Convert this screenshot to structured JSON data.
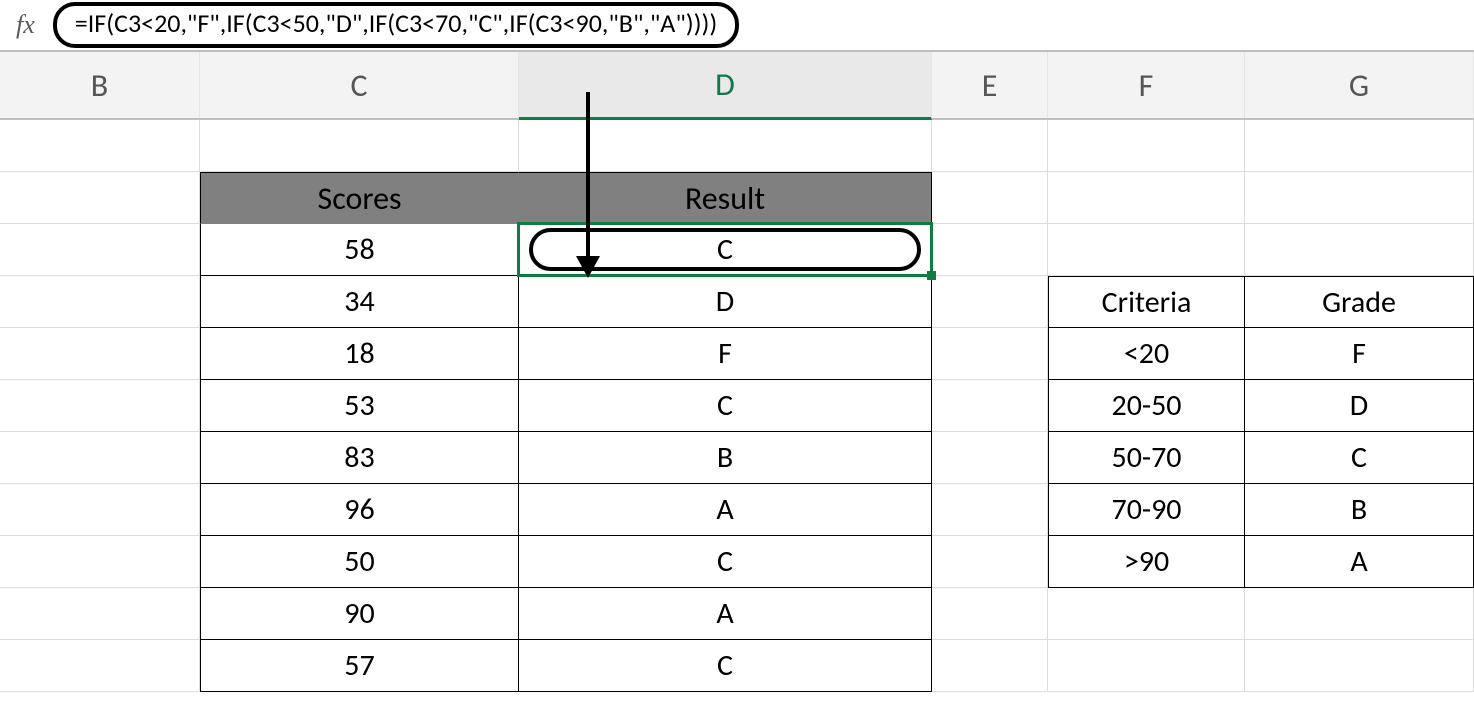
{
  "formula_bar": {
    "formula": "=IF(C3<20,\"F\",IF(C3<50,\"D\",IF(C3<70,\"C\",IF(C3<90,\"B\",\"A\"))))"
  },
  "col_headers": [
    "B",
    "C",
    "D",
    "E",
    "F",
    "G"
  ],
  "scores_table": {
    "headers": [
      "Scores",
      "Result"
    ],
    "rows": [
      {
        "score": "58",
        "result": "C"
      },
      {
        "score": "34",
        "result": "D"
      },
      {
        "score": "18",
        "result": "F"
      },
      {
        "score": "53",
        "result": "C"
      },
      {
        "score": "83",
        "result": "B"
      },
      {
        "score": "96",
        "result": "A"
      },
      {
        "score": "50",
        "result": "C"
      },
      {
        "score": "90",
        "result": "A"
      },
      {
        "score": "57",
        "result": "C"
      }
    ]
  },
  "criteria_table": {
    "headers": [
      "Criteria",
      "Grade"
    ],
    "rows": [
      {
        "c": "<20",
        "g": "F"
      },
      {
        "c": "20-50",
        "g": "D"
      },
      {
        "c": "50-70",
        "g": "C"
      },
      {
        "c": "70-90",
        "g": "B"
      },
      {
        "c": ">90",
        "g": "A"
      }
    ]
  }
}
